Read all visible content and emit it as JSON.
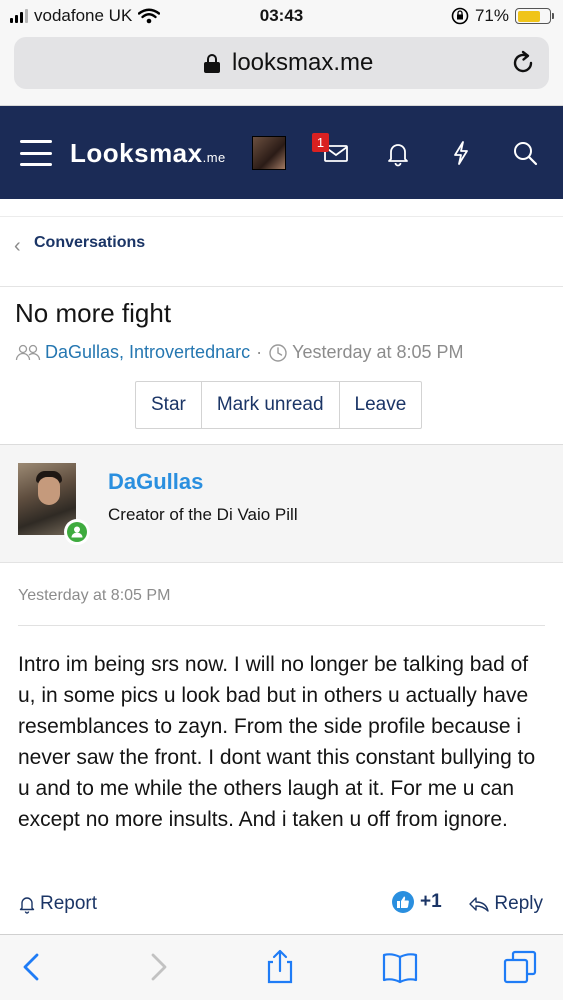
{
  "status_bar": {
    "carrier": "vodafone UK",
    "time": "03:43",
    "battery": "71%",
    "battery_level": 0.71,
    "icons": [
      "signal-icon",
      "wifi-icon",
      "orientation-lock-icon",
      "battery-icon"
    ]
  },
  "browser": {
    "url": "looksmax.me",
    "icons": [
      "lock-icon",
      "reload-icon"
    ]
  },
  "nav": {
    "logo": "Lo",
    "logo_rest": "oksmax",
    "logo_suffix": ".me",
    "badge_count": "1",
    "icons": [
      "menu-icon",
      "inbox-icon",
      "bell-icon",
      "bolt-icon",
      "search-icon"
    ]
  },
  "breadcrumb": {
    "label": "Conversations"
  },
  "conversation": {
    "title": "No more fight",
    "participants": "DaGullas, Introvertednarc",
    "separator": "·",
    "time": "Yesterday at 8:05 PM",
    "buttons": {
      "star": "Star",
      "mark_unread": "Mark unread",
      "leave": "Leave"
    }
  },
  "message": {
    "username": "DaGullas",
    "user_title": "Creator of the Di Vaio Pill",
    "timestamp": "Yesterday at 8:05 PM",
    "body": "Intro im being srs now. I will no longer be talking bad of u, in some pics u look bad but in others u actually have resemblances to zayn. From the side profile because i never saw the front. I dont want this constant bullying to u and to me while the others laugh at it. For me u can except no more insults. And i taken u off from ignore.",
    "actions": {
      "report": "Report",
      "like_count": "+1",
      "reply": "Reply"
    }
  },
  "toolbar": {
    "icons": [
      "back-icon",
      "forward-icon",
      "share-icon",
      "bookmarks-icon",
      "tabs-icon"
    ]
  },
  "colors": {
    "nav_bg": "#1b2b56",
    "link": "#2577b1",
    "username": "#2a8fdf",
    "badge": "#d92121",
    "online": "#3fab3f",
    "battery": "#f0c419"
  }
}
